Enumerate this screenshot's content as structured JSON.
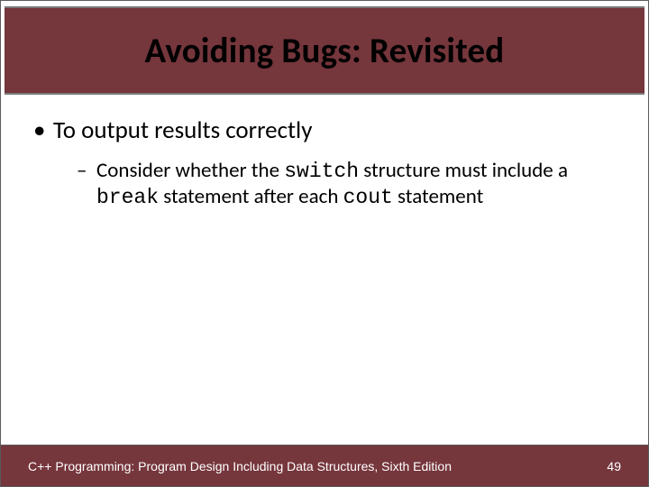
{
  "title": "Avoiding Bugs: Revisited",
  "bullets": {
    "l1": "To output results correctly",
    "l2_pre": "Consider whether the ",
    "l2_code1": "switch",
    "l2_mid1": " structure must include a ",
    "l2_code2": "break",
    "l2_mid2": " statement after each ",
    "l2_code3": "cout",
    "l2_post": " statement"
  },
  "footer": {
    "text": "C++ Programming: Program Design Including Data Structures, Sixth Edition",
    "page": "49"
  }
}
